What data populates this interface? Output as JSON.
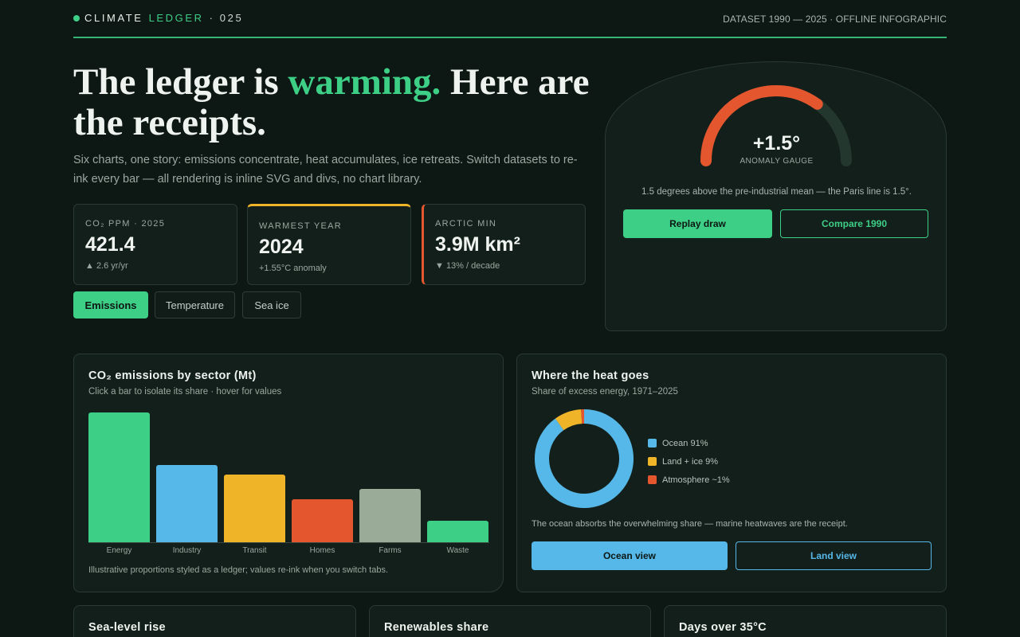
{
  "header": {
    "brand_main": "CLIMATE",
    "brand_accent": "LEDGER",
    "brand_issue": "· 025",
    "meta": "DATASET 1990 — 2025 · OFFLINE INFOGRAPHIC"
  },
  "hero": {
    "headline_a": "The ledger is ",
    "headline_green": "warming.",
    "headline_b": " Here are the receipts.",
    "lede": "Six charts, one story: emissions concentrate, heat accumulates, ice retreats. Switch datasets to re-ink every bar — all rendering is inline SVG and divs, no chart library."
  },
  "stats": [
    {
      "label": "CO₂ PPM · 2025",
      "value": "421.4",
      "delta": "▲ 2.6 yr/yr"
    },
    {
      "label": "WARMEST YEAR",
      "value": "2024",
      "delta": "+1.55°C anomaly"
    },
    {
      "label": "ARCTIC MIN",
      "value": "3.9M km²",
      "delta": "▼ 13% / decade"
    }
  ],
  "tabs": [
    {
      "label": "Emissions",
      "active": true
    },
    {
      "label": "Temperature",
      "active": false
    },
    {
      "label": "Sea ice",
      "active": false
    }
  ],
  "gauge": {
    "value_text": "+1.5°",
    "fill_fraction": 0.7,
    "label": "ANOMALY GAUGE",
    "caption": "1.5 degrees above the pre-industrial mean — the Paris line is 1.5°.",
    "replay_label": "Replay draw",
    "compare_label": "Compare 1990",
    "colors": {
      "fill": "#e4572e",
      "track": "#24372e"
    }
  },
  "bar_panel": {
    "title": "CO₂ emissions by sector (Mt)",
    "subtitle": "Click a bar to isolate its share · hover for values",
    "footnote": "Illustrative proportions styled as a ledger; values re-ink when you switch tabs."
  },
  "chart_data": [
    {
      "type": "bar",
      "categories": [
        "Energy",
        "Industry",
        "Transit",
        "Homes",
        "Farms",
        "Waste"
      ],
      "values": [
        100,
        59.5,
        52,
        33,
        41,
        16.5
      ],
      "ylim": [
        0,
        100
      ],
      "colors": [
        "#3ecf86",
        "#56b8e8",
        "#f0b429",
        "#e4572e",
        "#9aab98",
        "#3ecf86"
      ],
      "title": "CO₂ emissions by sector (Mt)"
    },
    {
      "type": "pie",
      "labels": [
        "Ocean 91%",
        "Land + ice 9%",
        "Atmosphere ~1%"
      ],
      "values": [
        91,
        9,
        1
      ],
      "colors": [
        "#56b8e8",
        "#f0b429",
        "#e4572e"
      ],
      "title": "Where the heat goes"
    }
  ],
  "donut_panel": {
    "title": "Where the heat goes",
    "subtitle": "Share of excess energy, 1971–2025",
    "caption": "The ocean absorbs the overwhelming share — marine heatwaves are the receipt.",
    "ocean_label": "Ocean view",
    "land_label": "Land view"
  },
  "mini_panels": [
    {
      "title": "Sea-level rise"
    },
    {
      "title": "Renewables share"
    },
    {
      "title": "Days over 35°C"
    }
  ]
}
